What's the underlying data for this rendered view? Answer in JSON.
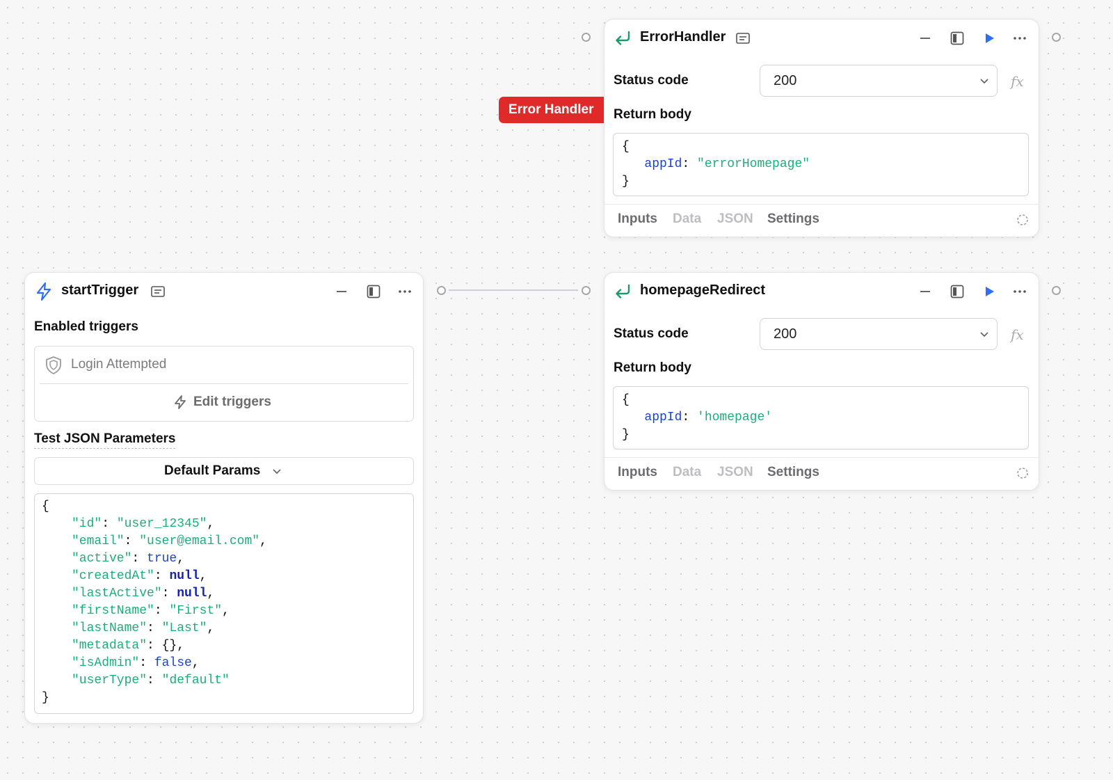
{
  "error_node": {
    "title": "ErrorHandler",
    "status_label": "Status code",
    "status_value": "200",
    "fx_label": "fx",
    "body_label": "Return body",
    "code": {
      "open": "{",
      "key": "appId",
      "colon": ": ",
      "value": "\"errorHomepage\"",
      "close": "}"
    },
    "tabs": [
      "Inputs",
      "Data",
      "JSON",
      "Settings"
    ]
  },
  "error_tag": "Error Handler",
  "redirect_node": {
    "title": "homepageRedirect",
    "status_label": "Status code",
    "status_value": "200",
    "fx_label": "fx",
    "body_label": "Return body",
    "code": {
      "open": "{",
      "key": "appId",
      "colon": ": ",
      "value": "'homepage'",
      "close": "}"
    },
    "tabs": [
      "Inputs",
      "Data",
      "JSON",
      "Settings"
    ]
  },
  "trigger_node": {
    "title": "startTrigger",
    "enabled_label": "Enabled triggers",
    "trigger_item": "Login Attempted",
    "edit_triggers": "Edit triggers",
    "test_label": "Test JSON Parameters",
    "params_select": "Default Params",
    "json": {
      "open": "{",
      "close": "}",
      "lines": [
        {
          "key": "\"id\"",
          "value": "\"user_12345\"",
          "vtype": "s",
          "comma": ","
        },
        {
          "key": "\"email\"",
          "value": "\"user@email.com\"",
          "vtype": "s",
          "comma": ","
        },
        {
          "key": "\"active\"",
          "value": "true",
          "vtype": "kb",
          "comma": ","
        },
        {
          "key": "\"createdAt\"",
          "value": "null",
          "vtype": "kw",
          "comma": ","
        },
        {
          "key": "\"lastActive\"",
          "value": "null",
          "vtype": "kw",
          "comma": ","
        },
        {
          "key": "\"firstName\"",
          "value": "\"First\"",
          "vtype": "s",
          "comma": ","
        },
        {
          "key": "\"lastName\"",
          "value": "\"Last\"",
          "vtype": "s",
          "comma": ","
        },
        {
          "key": "\"metadata\"",
          "value": "{}",
          "vtype": "p",
          "comma": ","
        },
        {
          "key": "\"isAdmin\"",
          "value": "false",
          "vtype": "kb",
          "comma": ","
        },
        {
          "key": "\"userType\"",
          "value": "\"default\"",
          "vtype": "s",
          "comma": ""
        }
      ]
    }
  },
  "colors": {
    "accent_blue": "#2f6ff5",
    "return_green": "#1c9a6c",
    "error_red": "#e02a2a",
    "code_green": "#1cae7a",
    "code_blue": "#1b44d2"
  }
}
